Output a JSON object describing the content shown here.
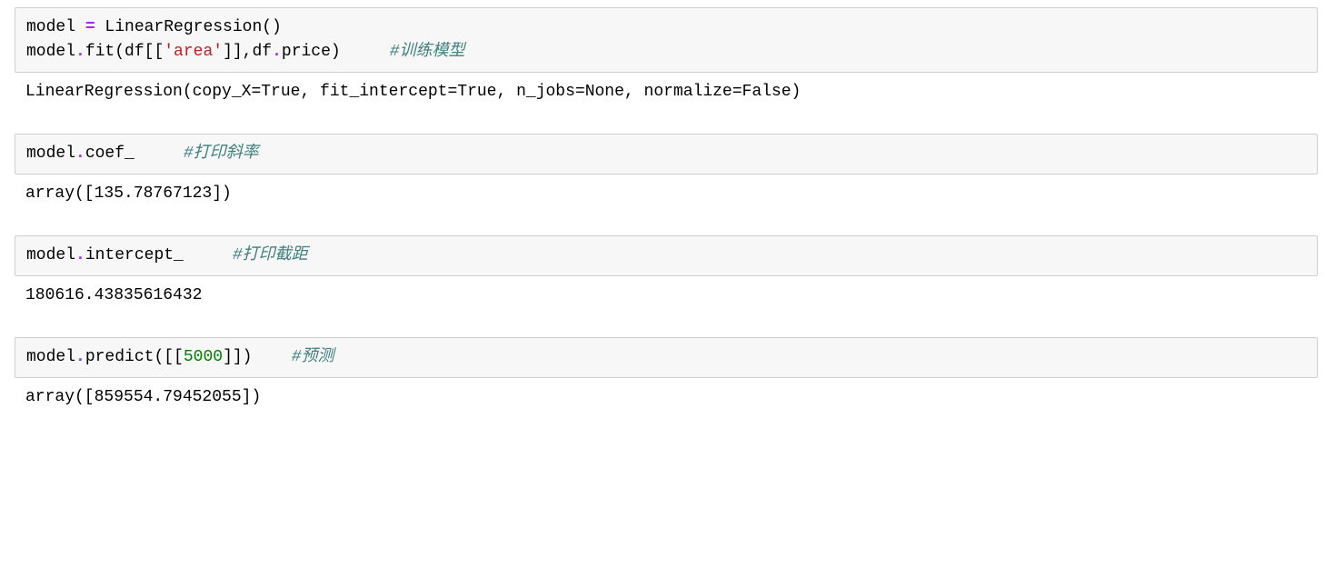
{
  "cells": [
    {
      "input": {
        "line1": {
          "t1": "model ",
          "op": "=",
          "t2": " LinearRegression()"
        },
        "line2": {
          "t1": "model",
          "dot1": ".",
          "t2": "fit(df[[",
          "str": "'area'",
          "t3": "]],df",
          "dot2": ".",
          "t4": "price)     ",
          "comment": "#训练模型"
        }
      },
      "output": "LinearRegression(copy_X=True, fit_intercept=True, n_jobs=None, normalize=False)"
    },
    {
      "input": {
        "line1": {
          "t1": "model",
          "dot1": ".",
          "t2": "coef_     ",
          "comment": "#打印斜率"
        }
      },
      "output": "array([135.78767123])"
    },
    {
      "input": {
        "line1": {
          "t1": "model",
          "dot1": ".",
          "t2": "intercept_     ",
          "comment": "#打印截距"
        }
      },
      "output": "180616.43835616432"
    },
    {
      "input": {
        "line1": {
          "t1": "model",
          "dot1": ".",
          "t2": "predict([[",
          "num": "5000",
          "t3": "]])    ",
          "comment": "#预测"
        }
      },
      "output": "array([859554.79452055])"
    }
  ]
}
